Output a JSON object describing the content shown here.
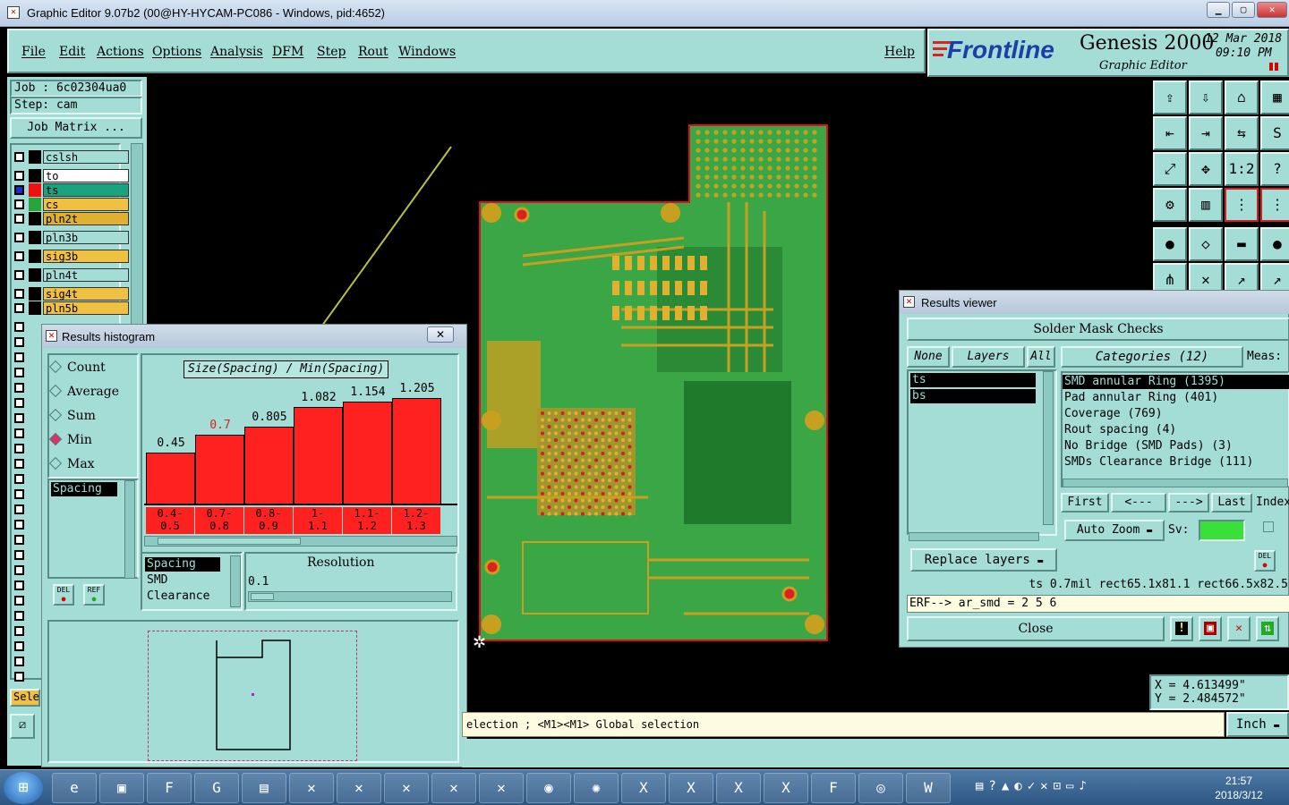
{
  "window": {
    "title": "Graphic Editor 9.07b2 (00@HY-HYCAM-PC086 - Windows, pid:4652)"
  },
  "menu": {
    "file": "File",
    "edit": "Edit",
    "actions": "Actions",
    "options": "Options",
    "analysis": "Analysis",
    "dfm": "DFM",
    "step": "Step",
    "rout": "Rout",
    "windows": "Windows",
    "help": "Help"
  },
  "branding": {
    "logo": "Frontline",
    "product": "Genesis 2000",
    "subtitle": "Graphic Editor",
    "date": "12 Mar 2018",
    "time": "09:10 PM"
  },
  "job": {
    "job_label": "Job : 6c02304ua0",
    "step_label": "Step: cam",
    "matrix_button": "Job Matrix ..."
  },
  "layers": [
    {
      "name": "cslsh",
      "color": "#a4dcd6"
    },
    {
      "name": "to",
      "color": "#ffffff"
    },
    {
      "name": "ts",
      "color": "#1aa37f"
    },
    {
      "name": "cs",
      "color": "#f0c040"
    },
    {
      "name": "pln2t",
      "color": "#e0b030"
    },
    {
      "name": "pln3b",
      "color": "#a4dcd6"
    },
    {
      "name": "sig3b",
      "color": "#f0c040"
    },
    {
      "name": "pln4t",
      "color": "#a4dcd6"
    },
    {
      "name": "sig4t",
      "color": "#f0c040"
    },
    {
      "name": "pln5b",
      "color": "#f0c040"
    }
  ],
  "left_bottom": {
    "sel_label": "Sele"
  },
  "histogram": {
    "title": "Results histogram",
    "modes": [
      "Count",
      "Average",
      "Sum",
      "Min",
      "Max"
    ],
    "selected_mode": "Min",
    "metric_list": [
      "Spacing"
    ],
    "del_label": "DEL",
    "ref_label": "REF",
    "chart_heading": "Size(Spacing) / Min(Spacing)",
    "bars": [
      {
        "label": "0.45",
        "value": 0.45,
        "bin_lo": "0.4-",
        "bin_hi": "0.5"
      },
      {
        "label": "0.7",
        "value": 0.7,
        "bin_lo": "0.7-",
        "bin_hi": "0.8"
      },
      {
        "label": "0.805",
        "value": 0.805,
        "bin_lo": "0.8-",
        "bin_hi": "0.9"
      },
      {
        "label": "1.082",
        "value": 1.082,
        "bin_lo": "1-",
        "bin_hi": "1.1"
      },
      {
        "label": "1.154",
        "value": 1.154,
        "bin_lo": "1.1-",
        "bin_hi": "1.2"
      },
      {
        "label": "1.205",
        "value": 1.205,
        "bin_lo": "1.2-",
        "bin_hi": "1.3"
      }
    ],
    "categories": [
      "Spacing",
      "SMD",
      "Clearance"
    ],
    "resolution_label": "Resolution",
    "resolution_value": "0.1"
  },
  "results_viewer": {
    "title": "Results viewer",
    "header": "Solder Mask Checks",
    "none_button": "None",
    "layers_button": "Layers",
    "all_button": "All",
    "layers": [
      "ts",
      "bs"
    ],
    "categories_button": "Categories (12)",
    "meas_label": "Meas:",
    "categories": [
      "SMD annular Ring (1395)",
      "Pad annular Ring (401)",
      "Coverage (769)",
      "Rout spacing (4)",
      "No Bridge (SMD Pads) (3)",
      "SMDs Clearance Bridge (111)"
    ],
    "first_button": "First",
    "prev_button": "<---",
    "next_button": "--->",
    "last_button": "Last",
    "index_label": "Index:",
    "auto_zoom": "Auto Zoom",
    "sv_label": "Sv:",
    "replace_layers": "Replace layers",
    "status_line": "ts 0.7mil  rect65.1x81.1  rect66.5x82.5",
    "erf_line": "ERF--> ar_smd = 2 5 6",
    "close_button": "Close",
    "del_label": "DEL"
  },
  "coords": {
    "x": "X = 4.613499\"",
    "y": "Y = 2.484572\""
  },
  "statusbar": {
    "hint": "election ; <M1><M1> Global selection",
    "units": "Inch"
  },
  "toolbar_icons": [
    "open-icon",
    "save-icon",
    "home-icon",
    "grid-icon",
    "prev-step-icon",
    "next-step-icon",
    "scale-icon",
    "curve-icon",
    "fit-icon",
    "center-icon",
    "ratio-icon",
    "help-icon",
    "measure-icon",
    "layers-icon",
    "net-icon",
    "net2-icon",
    "select-icon",
    "box-icon",
    "ruler-icon",
    "pad-icon",
    "node-icon",
    "cross-icon",
    "line-icon",
    "line2-icon"
  ],
  "taskbar": {
    "time": "21:57",
    "date": "2018/3/12"
  }
}
